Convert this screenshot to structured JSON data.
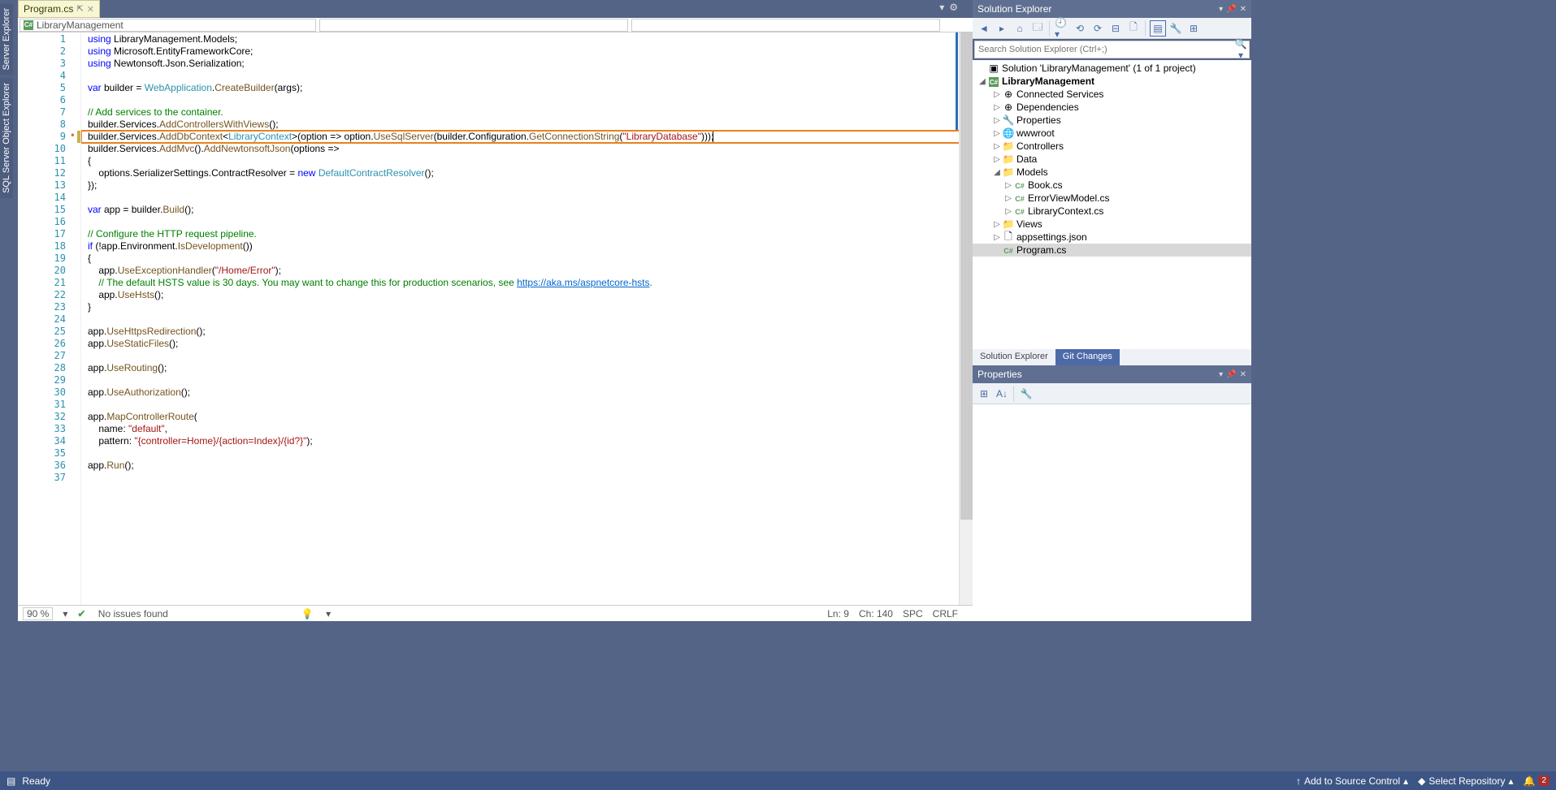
{
  "leftTabs": [
    "Server Explorer",
    "SQL Server Object Explorer"
  ],
  "tab": {
    "name": "Program.cs"
  },
  "navDrop": "LibraryManagement",
  "code": [
    {
      "n": 1,
      "html": "<span class='kw'>using</span> LibraryManagement.Models;"
    },
    {
      "n": 2,
      "html": "<span class='kw'>using</span> Microsoft.EntityFrameworkCore;"
    },
    {
      "n": 3,
      "html": "<span class='kw'>using</span> Newtonsoft.Json.Serialization;"
    },
    {
      "n": 4,
      "html": ""
    },
    {
      "n": 5,
      "html": "<span class='kw'>var</span> builder = <span class='typ'>WebApplication</span>.<span class='mth'>CreateBuilder</span>(args);"
    },
    {
      "n": 6,
      "html": ""
    },
    {
      "n": 7,
      "html": "<span class='cmt'>// Add services to the container.</span>"
    },
    {
      "n": 8,
      "html": "builder.Services.<span class='mth'>AddControllersWithViews</span>();"
    },
    {
      "n": 9,
      "hl": true,
      "edited": true,
      "dot": true,
      "html": "builder.Services.<span class='mth'>AddDbContext</span>&lt;<span class='typ'>LibraryContext</span>&gt;(option =&gt; option.<span class='mth'>UseSqlServer</span>(builder.Configuration.<span class='mth'>GetConnectionString</span>(<span class='str'>\"LibraryDatabase\"</span>)));<span class='cursor'></span>"
    },
    {
      "n": 10,
      "html": "builder.Services.<span class='mth'>AddMvc</span>().<span class='mth'>AddNewtonsoftJson</span>(options =&gt;"
    },
    {
      "n": 11,
      "html": "{"
    },
    {
      "n": 12,
      "html": "    options.SerializerSettings.ContractResolver = <span class='kw'>new</span> <span class='typ'>DefaultContractResolver</span>();"
    },
    {
      "n": 13,
      "html": "});"
    },
    {
      "n": 14,
      "html": ""
    },
    {
      "n": 15,
      "html": "<span class='kw'>var</span> app = builder.<span class='mth'>Build</span>();"
    },
    {
      "n": 16,
      "html": ""
    },
    {
      "n": 17,
      "html": "<span class='cmt'>// Configure the HTTP request pipeline.</span>"
    },
    {
      "n": 18,
      "html": "<span class='kw'>if</span> (!app.Environment.<span class='mth'>IsDevelopment</span>())"
    },
    {
      "n": 19,
      "html": "{"
    },
    {
      "n": 20,
      "html": "    app.<span class='mth'>UseExceptionHandler</span>(<span class='str'>\"/Home/Error\"</span>);"
    },
    {
      "n": 21,
      "html": "    <span class='cmt'>// The default HSTS value is 30 days. You may want to change this for production scenarios, see </span><span class='lnk'>https://aka.ms/aspnetcore-hsts</span><span class='cmt'>.</span>"
    },
    {
      "n": 22,
      "html": "    app.<span class='mth'>UseHsts</span>();"
    },
    {
      "n": 23,
      "html": "}"
    },
    {
      "n": 24,
      "html": ""
    },
    {
      "n": 25,
      "html": "app.<span class='mth'>UseHttpsRedirection</span>();"
    },
    {
      "n": 26,
      "html": "app.<span class='mth'>UseStaticFiles</span>();"
    },
    {
      "n": 27,
      "html": ""
    },
    {
      "n": 28,
      "html": "app.<span class='mth'>UseRouting</span>();"
    },
    {
      "n": 29,
      "html": ""
    },
    {
      "n": 30,
      "html": "app.<span class='mth'>UseAuthorization</span>();"
    },
    {
      "n": 31,
      "html": ""
    },
    {
      "n": 32,
      "html": "app.<span class='mth'>MapControllerRoute</span>("
    },
    {
      "n": 33,
      "html": "    name: <span class='str'>\"default\"</span>,"
    },
    {
      "n": 34,
      "html": "    pattern: <span class='str'>\"{controller=Home}/{action=Index}/{id?}\"</span>);"
    },
    {
      "n": 35,
      "html": ""
    },
    {
      "n": 36,
      "html": "app.<span class='mth'>Run</span>();"
    },
    {
      "n": 37,
      "html": ""
    }
  ],
  "footer": {
    "zoom": "90 %",
    "issues": "No issues found",
    "ln": "Ln: 9",
    "ch": "Ch: 140",
    "spc": "SPC",
    "crlf": "CRLF"
  },
  "se": {
    "title": "Solution Explorer",
    "searchPlaceholder": "Search Solution Explorer (Ctrl+;)",
    "tree": [
      {
        "ind": 0,
        "exp": "",
        "ico": "sln",
        "lbl": "Solution 'LibraryManagement' (1 of 1 project)"
      },
      {
        "ind": 0,
        "exp": "◢",
        "ico": "csproj",
        "lbl": "LibraryManagement",
        "bold": true
      },
      {
        "ind": 2,
        "exp": "▷",
        "ico": "ref",
        "lbl": "Connected Services"
      },
      {
        "ind": 2,
        "exp": "▷",
        "ico": "ref",
        "lbl": "Dependencies"
      },
      {
        "ind": 2,
        "exp": "▷",
        "ico": "wrench",
        "lbl": "Properties"
      },
      {
        "ind": 2,
        "exp": "▷",
        "ico": "globe",
        "lbl": "wwwroot"
      },
      {
        "ind": 2,
        "exp": "▷",
        "ico": "fold",
        "lbl": "Controllers"
      },
      {
        "ind": 2,
        "exp": "▷",
        "ico": "fold",
        "lbl": "Data"
      },
      {
        "ind": 2,
        "exp": "◢",
        "ico": "fold",
        "lbl": "Models"
      },
      {
        "ind": 3,
        "exp": "▷",
        "ico": "cs",
        "lbl": "Book.cs"
      },
      {
        "ind": 3,
        "exp": "▷",
        "ico": "cs",
        "lbl": "ErrorViewModel.cs"
      },
      {
        "ind": 3,
        "exp": "▷",
        "ico": "cs",
        "lbl": "LibraryContext.cs"
      },
      {
        "ind": 2,
        "exp": "▷",
        "ico": "fold",
        "lbl": "Views"
      },
      {
        "ind": 2,
        "exp": "▷",
        "ico": "json",
        "lbl": "appsettings.json"
      },
      {
        "ind": 2,
        "exp": "",
        "ico": "cs",
        "lbl": "Program.cs",
        "sel": true
      }
    ],
    "tabs": [
      "Solution Explorer",
      "Git Changes"
    ]
  },
  "props": {
    "title": "Properties"
  },
  "status": {
    "ready": "Ready",
    "addSrc": "Add to Source Control",
    "selRepo": "Select Repository",
    "notif": "2"
  }
}
